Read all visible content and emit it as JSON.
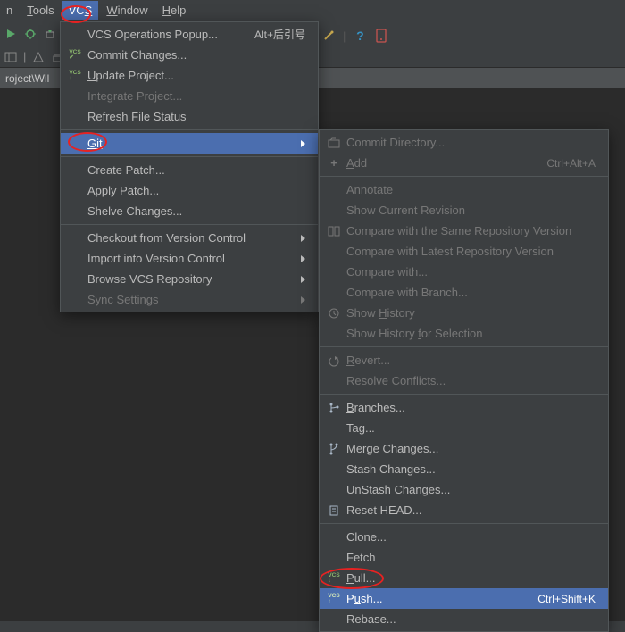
{
  "menubar": {
    "items": [
      {
        "label": "n"
      },
      {
        "label": "Tools"
      },
      {
        "label": "VCS"
      },
      {
        "label": "Window"
      },
      {
        "label": "Help"
      }
    ]
  },
  "toolbar_right": {
    "help": "?"
  },
  "breadcrumb": "roject\\Wil",
  "vcs_menu": {
    "ops_popup": "VCS Operations Popup...",
    "ops_popup_sc": "Alt+后引号",
    "commit": "Commit Changes...",
    "update": "Update Project...",
    "integrate": "Integrate Project...",
    "refresh": "Refresh File Status",
    "git": "Git",
    "create_patch": "Create Patch...",
    "apply_patch": "Apply Patch...",
    "shelve": "Shelve Changes...",
    "checkout": "Checkout from Version Control",
    "import": "Import into Version Control",
    "browse": "Browse VCS Repository",
    "sync": "Sync Settings"
  },
  "git_menu": {
    "commit_dir": "Commit Directory...",
    "add": "Add",
    "add_sc": "Ctrl+Alt+A",
    "annotate": "Annotate",
    "show_current": "Show Current Revision",
    "compare_same": "Compare with the Same Repository Version",
    "compare_latest": "Compare with Latest Repository Version",
    "compare_with": "Compare with...",
    "compare_branch": "Compare with Branch...",
    "show_history": "Show History",
    "show_history_sel": "Show History for Selection",
    "revert": "Revert...",
    "resolve": "Resolve Conflicts...",
    "branches": "Branches...",
    "tag": "Tag...",
    "merge": "Merge Changes...",
    "stash": "Stash Changes...",
    "unstash": "UnStash Changes...",
    "reset": "Reset HEAD...",
    "clone": "Clone...",
    "fetch": "Fetch",
    "pull": "Pull...",
    "push": "Push...",
    "push_sc": "Ctrl+Shift+K",
    "rebase": "Rebase..."
  }
}
